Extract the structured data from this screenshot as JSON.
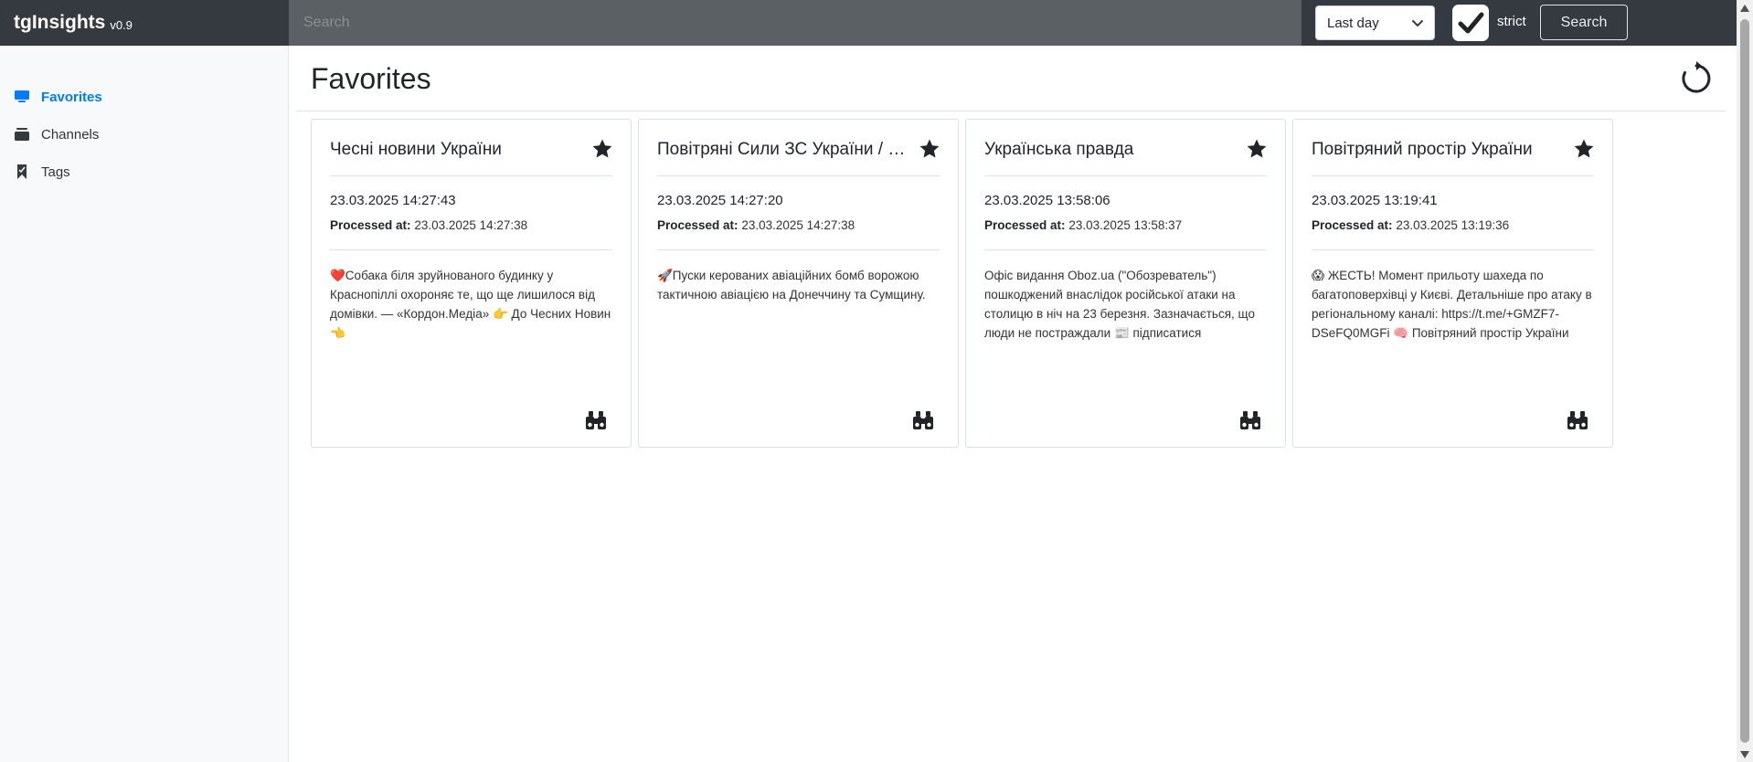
{
  "app": {
    "name": "tgInsights",
    "version": "v0.9"
  },
  "search": {
    "placeholder": "Search",
    "value": "",
    "period_selected": "Last day",
    "strict_checked": true,
    "strict_label": "strict",
    "button_label": "Search"
  },
  "sidebar": {
    "items": [
      {
        "label": "Favorites",
        "icon": "monitor-icon",
        "active": true
      },
      {
        "label": "Channels",
        "icon": "inbox-stack-icon",
        "active": false
      },
      {
        "label": "Tags",
        "icon": "bookmark-icon",
        "active": false
      }
    ]
  },
  "page": {
    "title": "Favorites"
  },
  "cards": [
    {
      "title": "Чесні новини України",
      "date": "23.03.2025 14:27:43",
      "processed_label": "Processed at:",
      "processed_at": "23.03.2025 14:27:38",
      "text": "❤️Собака біля зруйнованого будинку у Краснопіллі охороняє те, що ще лишилося від домівки. — «Кордон.Медіа» 👉 До Чесних Новин 👈"
    },
    {
      "title": "Повітряні Сили ЗС України / ПС ЗСУ",
      "date": "23.03.2025 14:27:20",
      "processed_label": "Processed at:",
      "processed_at": "23.03.2025 14:27:38",
      "text": "🚀Пуски керованих авіаційних бомб ворожою тактичною авіацією на Донеччину та Сумщину."
    },
    {
      "title": "Українська правда",
      "date": "23.03.2025 13:58:06",
      "processed_label": "Processed at:",
      "processed_at": "23.03.2025 13:58:37",
      "text": "Офіс видання Oboz.ua (\"Обозреватель\") пошкоджений внаслідок російської атаки на столицю в ніч на 23 березня. Зазначається, що люди не постраждали 📰 підписатися"
    },
    {
      "title": "Повітряний простір України",
      "date": "23.03.2025 13:19:41",
      "processed_label": "Processed at:",
      "processed_at": "23.03.2025 13:19:36",
      "text": "😱 ЖЕСТЬ! Момент прильоту шахеда по багатоповерхівці у Києві. Детальніше про атаку в регіональному каналі: https://t.me/+GMZF7-DSeFQ0MGFi 🧠 Повітряний простір України"
    }
  ],
  "colors": {
    "navbar": "#343a40",
    "search_bg": "#5b6065",
    "sidebar_bg": "#f8f9fa",
    "accent": "#007bff",
    "text": "#212529"
  }
}
